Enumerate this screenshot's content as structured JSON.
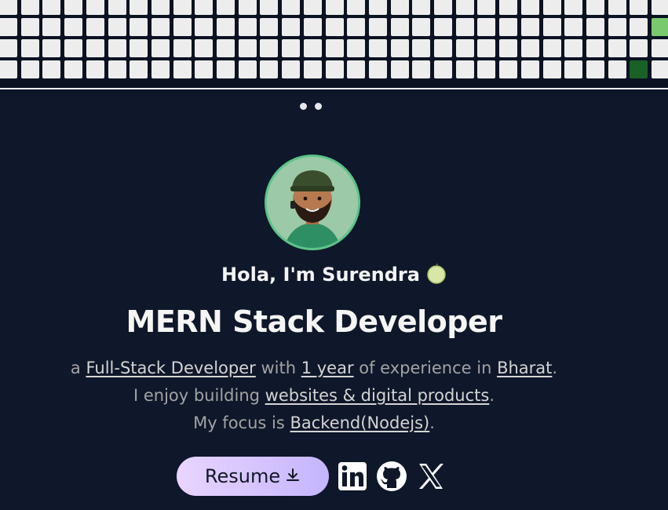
{
  "hero": {
    "greeting": "Hola, I'm Surendra",
    "title": "MERN Stack Developer",
    "line1": {
      "prefix": "a ",
      "link1": "Full-Stack Developer",
      "mid1": " with ",
      "link2": "1 year",
      "mid2": " of experience in ",
      "link3": "Bharat",
      "suffix": "."
    },
    "line2": {
      "prefix": "I enjoy building ",
      "link": "websites & digital products",
      "suffix": "."
    },
    "line3": {
      "prefix": "My focus is ",
      "link": "Backend(Nodejs)",
      "suffix": "."
    }
  },
  "actions": {
    "resume_label": "Resume",
    "resume_icon": "download-icon",
    "social": [
      "linkedin-icon",
      "github-icon",
      "x-icon"
    ]
  },
  "contribution_graph": {
    "colors": {
      "empty": "#ededed",
      "light": "#7bc96f",
      "dark": "#196127"
    }
  }
}
